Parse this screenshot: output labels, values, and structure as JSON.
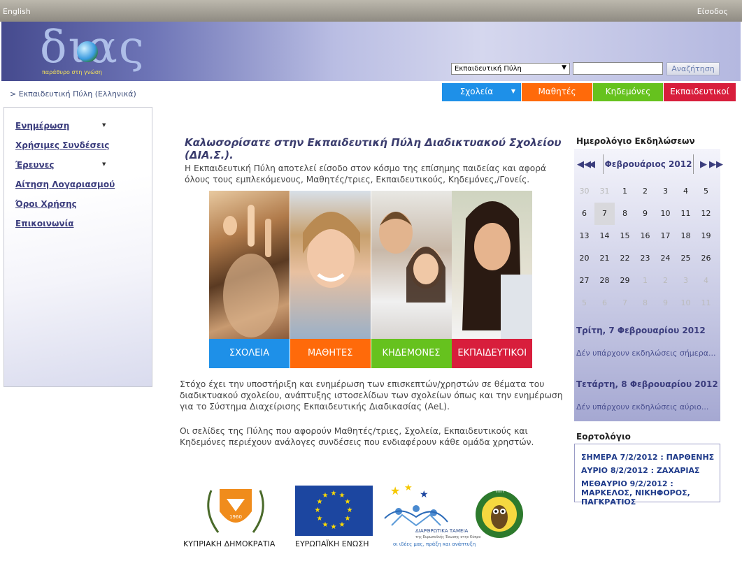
{
  "topbar": {
    "language": "English",
    "login": "Είσοδος"
  },
  "logo": {
    "wordmark": "διας",
    "tagline": "παράθυρο στη γνώση"
  },
  "search": {
    "scope_selected": "Εκπαιδευτική Πύλη",
    "query": "",
    "button_label": "Αναζήτηση"
  },
  "breadcrumb": "> Εκπαιδευτική Πύλη (Ελληνικά)",
  "nav": {
    "tabs": [
      {
        "label": "Σχολεία",
        "color": "#1e90e8",
        "has_dropdown": true
      },
      {
        "label": "Μαθητές",
        "color": "#ff6a0a"
      },
      {
        "label": "Κηδεμόνες",
        "color": "#66c21e"
      },
      {
        "label": "Εκπαιδευτικοί",
        "color": "#d81e3c"
      }
    ]
  },
  "sidebar": {
    "items": [
      {
        "label": "Ενημέρωση",
        "has_dropdown": true
      },
      {
        "label": "Χρήσιμες Συνδέσεις"
      },
      {
        "label": "Έρευνες",
        "has_dropdown": true
      },
      {
        "label": "Αίτηση Λογαριασμού"
      },
      {
        "label": "Όροι Χρήσης"
      },
      {
        "label": "Επικοινωνία"
      }
    ]
  },
  "main": {
    "welcome_title": "Καλωσορίσατε στην Εκπαιδευτική  Πύλη Διαδικτυακού Σχολείου (ΔΙΑ.Σ.).",
    "intro": "Η Εκπαιδευτική Πύλη αποτελεί είσοδο στον κόσμο της επίσημης παιδείας και αφορά όλους τους εμπλεκόμενους, Μαθητές/τριες, Εκπαιδευτικούς, Κηδεμόνες,/Γονείς.",
    "photo_tiles": [
      {
        "label": "ΣΧΟΛΕΙΑ",
        "color": "#1e90e8"
      },
      {
        "label": "ΜΑΘΗΤΕΣ",
        "color": "#ff6a0a"
      },
      {
        "label": "ΚΗΔΕΜΟΝΕΣ",
        "color": "#66c21e"
      },
      {
        "label": "ΕΚΠΑΙΔΕΥΤΙΚΟΙ",
        "color": "#d81e3c"
      }
    ],
    "paragraph1": "Στόχο έχει την υποστήριξη και ενημέρωση των επισκεπτών/χρηστών σε θέματα του διαδικτυακού σχολείου, ανάπτυξης ιστοσελίδων των σχολείων όπως και την ενημέρωση για το Σύστημα Διαχείρισης  Εκπαιδευτικής Διαδικασίας (AeL).",
    "paragraph2": "Οι σελίδες της Πύλης που αφορούν Μαθητές/τριες, Σχολεία, Εκπαιδευτικούς και Κηδεμόνες περιέχουν ανάλογες συνδέσεις που ενδιαφέρουν κάθε ομάδα χρηστών.",
    "logos": {
      "cyprus": "ΚΥΠΡΙΑΚΗ ΔΗΜΟΚΡΑΤΙΑ",
      "cyprus_seal_year": "1960",
      "eu": "ΕΥΡΩΠΑΪΚΗ ΕΝΩΣΗ",
      "funds_title": "ΔΙΑΡΘΡΩΤΙΚΑ ΤΑΜΕΙΑ",
      "funds_sub": "της Ευρωπαϊκής Ένωσης στην Κύπρο",
      "funds_slogan": "οι ιδέες μας, πράξη και ανάπτυξη",
      "ministry_badge": "ΥΠΠ"
    }
  },
  "calendar": {
    "heading": "Ημερολόγιο Εκδηλώσεων",
    "month": "Φεβρουάριος 2012",
    "weeks": [
      [
        "30",
        "31",
        "1",
        "2",
        "3",
        "4",
        "5"
      ],
      [
        "6",
        "7",
        "8",
        "9",
        "10",
        "11",
        "12"
      ],
      [
        "13",
        "14",
        "15",
        "16",
        "17",
        "18",
        "19"
      ],
      [
        "20",
        "21",
        "22",
        "23",
        "24",
        "25",
        "26"
      ],
      [
        "27",
        "28",
        "29",
        "1",
        "2",
        "3",
        "4"
      ],
      [
        "5",
        "6",
        "7",
        "8",
        "9",
        "10",
        "11"
      ]
    ],
    "today": "7",
    "events": [
      {
        "date": "Τρίτη, 7 Φεβρουαρίου 2012",
        "text": "Δέν υπάρχουν εκδηλώσεις σήμερα..."
      },
      {
        "date": "Τετάρτη, 8 Φεβρουαρίου 2012",
        "text": "Δέν υπάρχουν εκδηλώσεις αύριο..."
      }
    ]
  },
  "feasts": {
    "heading": "Εορτολόγιο",
    "items": [
      "ΣΗΜΕΡΑ 7/2/2012 : ΠΑΡΘΕΝΗΣ",
      "ΑΥΡΙΟ 8/2/2012 : ΖΑΧΑΡΙΑΣ",
      "ΜΕΘΑΥΡΙΟ 9/2/2012 : ΜΑΡΚΕΛΟΣ, ΝΙΚΗΦΟΡΟΣ, ΠΑΓΚΡΑΤΙΟΣ"
    ]
  }
}
